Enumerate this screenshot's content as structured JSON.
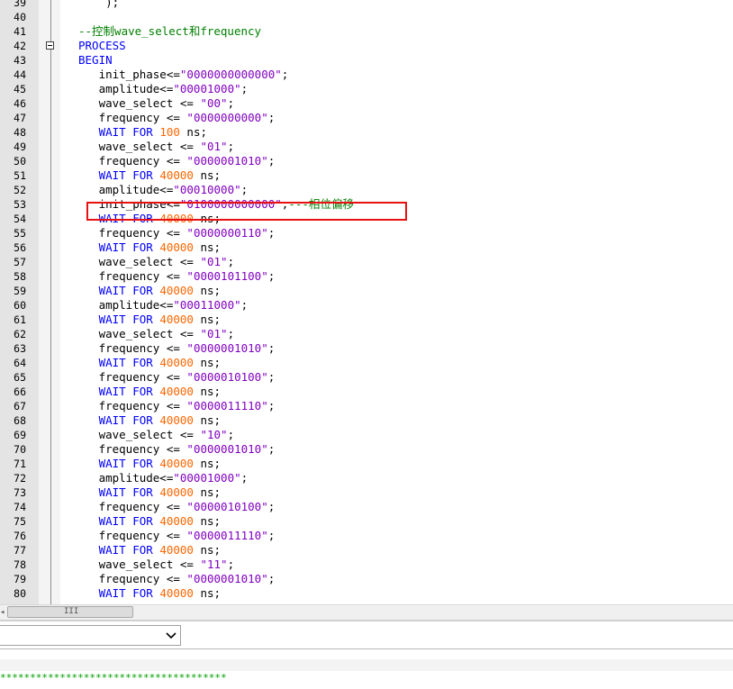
{
  "editor": {
    "lines": [
      {
        "n": "39",
        "tokens": [
          {
            "t": "    );",
            "c": "plain"
          }
        ]
      },
      {
        "n": "40",
        "tokens": []
      },
      {
        "n": "41",
        "tokens": [
          {
            "t": "--控制wave_select和frequency",
            "c": "com"
          }
        ]
      },
      {
        "n": "42",
        "fold": true,
        "tokens": [
          {
            "t": "PROCESS",
            "c": "kw"
          }
        ]
      },
      {
        "n": "43",
        "tokens": [
          {
            "t": "BEGIN",
            "c": "kw"
          }
        ]
      },
      {
        "n": "44",
        "tokens": [
          {
            "t": "   init_phase<=",
            "c": "plain"
          },
          {
            "t": "\"0000000000000\"",
            "c": "str"
          },
          {
            "t": ";",
            "c": "plain"
          }
        ]
      },
      {
        "n": "45",
        "tokens": [
          {
            "t": "   amplitude<=",
            "c": "plain"
          },
          {
            "t": "\"00001000\"",
            "c": "str"
          },
          {
            "t": ";",
            "c": "plain"
          }
        ]
      },
      {
        "n": "46",
        "tokens": [
          {
            "t": "   wave_select <= ",
            "c": "plain"
          },
          {
            "t": "\"00\"",
            "c": "str"
          },
          {
            "t": ";",
            "c": "plain"
          }
        ]
      },
      {
        "n": "47",
        "tokens": [
          {
            "t": "   frequency <= ",
            "c": "plain"
          },
          {
            "t": "\"0000000000\"",
            "c": "str"
          },
          {
            "t": ";",
            "c": "plain"
          }
        ]
      },
      {
        "n": "48",
        "tokens": [
          {
            "t": "   ",
            "c": "plain"
          },
          {
            "t": "WAIT FOR",
            "c": "kw"
          },
          {
            "t": " ",
            "c": "plain"
          },
          {
            "t": "100",
            "c": "num"
          },
          {
            "t": " ns;",
            "c": "plain"
          }
        ]
      },
      {
        "n": "49",
        "tokens": [
          {
            "t": "   wave_select <= ",
            "c": "plain"
          },
          {
            "t": "\"01\"",
            "c": "str"
          },
          {
            "t": ";",
            "c": "plain"
          }
        ]
      },
      {
        "n": "50",
        "tokens": [
          {
            "t": "   frequency <= ",
            "c": "plain"
          },
          {
            "t": "\"0000001010\"",
            "c": "str"
          },
          {
            "t": ";",
            "c": "plain"
          }
        ]
      },
      {
        "n": "51",
        "tokens": [
          {
            "t": "   ",
            "c": "plain"
          },
          {
            "t": "WAIT FOR",
            "c": "kw"
          },
          {
            "t": " ",
            "c": "plain"
          },
          {
            "t": "40000",
            "c": "num"
          },
          {
            "t": " ns;",
            "c": "plain"
          }
        ]
      },
      {
        "n": "52",
        "tokens": [
          {
            "t": "   amplitude<=",
            "c": "plain"
          },
          {
            "t": "\"00010000\"",
            "c": "str"
          },
          {
            "t": ";",
            "c": "plain"
          }
        ]
      },
      {
        "n": "53",
        "tokens": [
          {
            "t": "   init_phase<=",
            "c": "plain"
          },
          {
            "t": "\"0100000000000\"",
            "c": "str"
          },
          {
            "t": ";",
            "c": "plain"
          },
          {
            "t": "---相位偏移",
            "c": "com"
          }
        ]
      },
      {
        "n": "54",
        "tokens": [
          {
            "t": "   ",
            "c": "plain"
          },
          {
            "t": "WAIT FOR",
            "c": "kw"
          },
          {
            "t": " ",
            "c": "plain"
          },
          {
            "t": "40000",
            "c": "num"
          },
          {
            "t": " ns;",
            "c": "plain"
          }
        ]
      },
      {
        "n": "55",
        "tokens": [
          {
            "t": "   frequency <= ",
            "c": "plain"
          },
          {
            "t": "\"0000000110\"",
            "c": "str"
          },
          {
            "t": ";",
            "c": "plain"
          }
        ]
      },
      {
        "n": "56",
        "tokens": [
          {
            "t": "   ",
            "c": "plain"
          },
          {
            "t": "WAIT FOR",
            "c": "kw"
          },
          {
            "t": " ",
            "c": "plain"
          },
          {
            "t": "40000",
            "c": "num"
          },
          {
            "t": " ns;",
            "c": "plain"
          }
        ]
      },
      {
        "n": "57",
        "tokens": [
          {
            "t": "   wave_select <= ",
            "c": "plain"
          },
          {
            "t": "\"01\"",
            "c": "str"
          },
          {
            "t": ";",
            "c": "plain"
          }
        ]
      },
      {
        "n": "58",
        "tokens": [
          {
            "t": "   frequency <= ",
            "c": "plain"
          },
          {
            "t": "\"0000101100\"",
            "c": "str"
          },
          {
            "t": ";",
            "c": "plain"
          }
        ]
      },
      {
        "n": "59",
        "tokens": [
          {
            "t": "   ",
            "c": "plain"
          },
          {
            "t": "WAIT FOR",
            "c": "kw"
          },
          {
            "t": " ",
            "c": "plain"
          },
          {
            "t": "40000",
            "c": "num"
          },
          {
            "t": " ns;",
            "c": "plain"
          }
        ]
      },
      {
        "n": "60",
        "tokens": [
          {
            "t": "   amplitude<=",
            "c": "plain"
          },
          {
            "t": "\"00011000\"",
            "c": "str"
          },
          {
            "t": ";",
            "c": "plain"
          }
        ]
      },
      {
        "n": "61",
        "tokens": [
          {
            "t": "   ",
            "c": "plain"
          },
          {
            "t": "WAIT FOR",
            "c": "kw"
          },
          {
            "t": " ",
            "c": "plain"
          },
          {
            "t": "40000",
            "c": "num"
          },
          {
            "t": " ns;",
            "c": "plain"
          }
        ]
      },
      {
        "n": "62",
        "tokens": [
          {
            "t": "   wave_select <= ",
            "c": "plain"
          },
          {
            "t": "\"01\"",
            "c": "str"
          },
          {
            "t": ";",
            "c": "plain"
          }
        ]
      },
      {
        "n": "63",
        "tokens": [
          {
            "t": "   frequency <= ",
            "c": "plain"
          },
          {
            "t": "\"0000001010\"",
            "c": "str"
          },
          {
            "t": ";",
            "c": "plain"
          }
        ]
      },
      {
        "n": "64",
        "tokens": [
          {
            "t": "   ",
            "c": "plain"
          },
          {
            "t": "WAIT FOR",
            "c": "kw"
          },
          {
            "t": " ",
            "c": "plain"
          },
          {
            "t": "40000",
            "c": "num"
          },
          {
            "t": " ns;",
            "c": "plain"
          }
        ]
      },
      {
        "n": "65",
        "tokens": [
          {
            "t": "   frequency <= ",
            "c": "plain"
          },
          {
            "t": "\"0000010100\"",
            "c": "str"
          },
          {
            "t": ";",
            "c": "plain"
          }
        ]
      },
      {
        "n": "66",
        "tokens": [
          {
            "t": "   ",
            "c": "plain"
          },
          {
            "t": "WAIT FOR",
            "c": "kw"
          },
          {
            "t": " ",
            "c": "plain"
          },
          {
            "t": "40000",
            "c": "num"
          },
          {
            "t": " ns;",
            "c": "plain"
          }
        ]
      },
      {
        "n": "67",
        "tokens": [
          {
            "t": "   frequency <= ",
            "c": "plain"
          },
          {
            "t": "\"0000011110\"",
            "c": "str"
          },
          {
            "t": ";",
            "c": "plain"
          }
        ]
      },
      {
        "n": "68",
        "tokens": [
          {
            "t": "   ",
            "c": "plain"
          },
          {
            "t": "WAIT FOR",
            "c": "kw"
          },
          {
            "t": " ",
            "c": "plain"
          },
          {
            "t": "40000",
            "c": "num"
          },
          {
            "t": " ns;",
            "c": "plain"
          }
        ]
      },
      {
        "n": "69",
        "tokens": [
          {
            "t": "   wave_select <= ",
            "c": "plain"
          },
          {
            "t": "\"10\"",
            "c": "str"
          },
          {
            "t": ";",
            "c": "plain"
          }
        ]
      },
      {
        "n": "70",
        "tokens": [
          {
            "t": "   frequency <= ",
            "c": "plain"
          },
          {
            "t": "\"0000001010\"",
            "c": "str"
          },
          {
            "t": ";",
            "c": "plain"
          }
        ]
      },
      {
        "n": "71",
        "tokens": [
          {
            "t": "   ",
            "c": "plain"
          },
          {
            "t": "WAIT FOR",
            "c": "kw"
          },
          {
            "t": " ",
            "c": "plain"
          },
          {
            "t": "40000",
            "c": "num"
          },
          {
            "t": " ns;",
            "c": "plain"
          }
        ]
      },
      {
        "n": "72",
        "tokens": [
          {
            "t": "   amplitude<=",
            "c": "plain"
          },
          {
            "t": "\"00001000\"",
            "c": "str"
          },
          {
            "t": ";",
            "c": "plain"
          }
        ]
      },
      {
        "n": "73",
        "tokens": [
          {
            "t": "   ",
            "c": "plain"
          },
          {
            "t": "WAIT FOR",
            "c": "kw"
          },
          {
            "t": " ",
            "c": "plain"
          },
          {
            "t": "40000",
            "c": "num"
          },
          {
            "t": " ns;",
            "c": "plain"
          }
        ]
      },
      {
        "n": "74",
        "tokens": [
          {
            "t": "   frequency <= ",
            "c": "plain"
          },
          {
            "t": "\"0000010100\"",
            "c": "str"
          },
          {
            "t": ";",
            "c": "plain"
          }
        ]
      },
      {
        "n": "75",
        "tokens": [
          {
            "t": "   ",
            "c": "plain"
          },
          {
            "t": "WAIT FOR",
            "c": "kw"
          },
          {
            "t": " ",
            "c": "plain"
          },
          {
            "t": "40000",
            "c": "num"
          },
          {
            "t": " ns;",
            "c": "plain"
          }
        ]
      },
      {
        "n": "76",
        "tokens": [
          {
            "t": "   frequency <= ",
            "c": "plain"
          },
          {
            "t": "\"0000011110\"",
            "c": "str"
          },
          {
            "t": ";",
            "c": "plain"
          }
        ]
      },
      {
        "n": "77",
        "tokens": [
          {
            "t": "   ",
            "c": "plain"
          },
          {
            "t": "WAIT FOR",
            "c": "kw"
          },
          {
            "t": " ",
            "c": "plain"
          },
          {
            "t": "40000",
            "c": "num"
          },
          {
            "t": " ns;",
            "c": "plain"
          }
        ]
      },
      {
        "n": "78",
        "tokens": [
          {
            "t": "   wave_select <= ",
            "c": "plain"
          },
          {
            "t": "\"11\"",
            "c": "str"
          },
          {
            "t": ";",
            "c": "plain"
          }
        ]
      },
      {
        "n": "79",
        "tokens": [
          {
            "t": "   frequency <= ",
            "c": "plain"
          },
          {
            "t": "\"0000001010\"",
            "c": "str"
          },
          {
            "t": ";",
            "c": "plain"
          }
        ]
      },
      {
        "n": "80",
        "tokens": [
          {
            "t": "   ",
            "c": "plain"
          },
          {
            "t": "WAIT FOR",
            "c": "kw"
          },
          {
            "t": " ",
            "c": "plain"
          },
          {
            "t": "40000",
            "c": "num"
          },
          {
            "t": " ns;",
            "c": "plain"
          }
        ]
      }
    ],
    "highlighted_line": "53",
    "colors": {
      "keyword": "#0000ff",
      "number": "#ff6600",
      "string": "#8000c0",
      "comment": "#008000",
      "highlight_box": "#e81010"
    }
  },
  "scrollbar": {
    "left_arrow_icon": "left-arrow-icon",
    "grip_glyph": "III"
  },
  "bottom_panel": {
    "dropdown_value": "",
    "dropdown_icon": "chevron-down-icon",
    "output_text": "**************************************"
  }
}
